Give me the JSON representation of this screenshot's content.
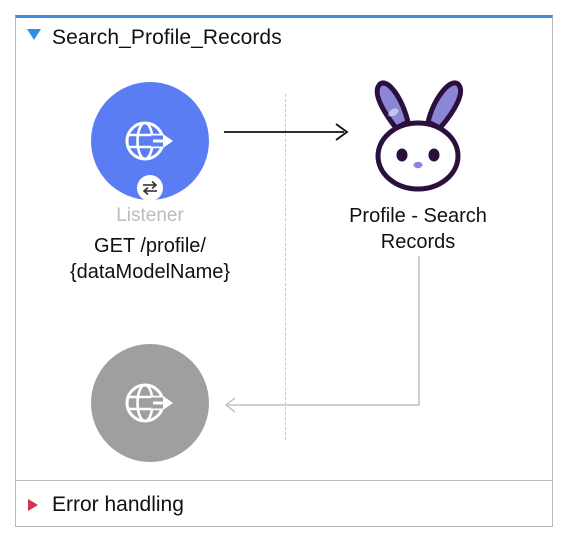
{
  "flow": {
    "title": "Search_Profile_Records"
  },
  "listener": {
    "caption": "Listener",
    "detail_line1": "GET /profile/",
    "detail_line2": "{dataModelName}",
    "accent_color": "#5a7df3",
    "icon": "globe-arrow-icon",
    "badge_icon": "swap-arrows-icon"
  },
  "component": {
    "label_line1": "Profile - Search",
    "label_line2": "Records",
    "icon": "bunny-icon"
  },
  "response": {
    "color": "#9f9f9f",
    "icon": "globe-arrow-icon"
  },
  "error_handling": {
    "label": "Error handling"
  },
  "colors": {
    "header_border": "#3f8fdf",
    "collapse_triangle": "#2f8fe6",
    "expand_triangle": "#d2334d",
    "bunny_ear": "#8b86d6",
    "bunny_outline": "#2b0f3d"
  }
}
